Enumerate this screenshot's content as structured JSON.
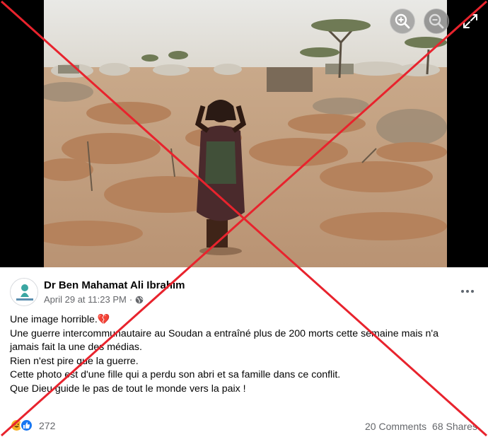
{
  "viewer": {
    "photo_alt": "Girl standing among fresh graves in a dry camp",
    "zoom_in_icon": "zoom-in-icon",
    "zoom_out_icon": "zoom-out-icon",
    "fullscreen_icon": "fullscreen-icon"
  },
  "post": {
    "author": "Dr Ben Mahamat Ali Ibrahim",
    "date": "April 29 at 11:23 PM",
    "separator": "·",
    "audience_icon": "globe-icon",
    "lines": [
      "Une image horrible.",
      "Une guerre intercommunautaire au Soudan a entraîné plus de 200 morts cette semaine mais n'a",
      "jamais fait la une des médias.",
      "Rien n'est pire que la guerre.",
      "Cette photo est d'une fille qui a perdu son abri et sa famille dans ce conflit.",
      "Que Dieu guide le pas de tout le monde vers la paix !"
    ],
    "emoji_after_first_line": "💔"
  },
  "footer": {
    "reaction_count": "272",
    "comments": "20 Comments",
    "shares": "68 Shares"
  },
  "overlay": {
    "cross_color": "#e8232d",
    "meaning": "fact-check-false-cross"
  },
  "colors": {
    "text": "#050505",
    "muted": "#65676b",
    "like_blue": "#1877f2",
    "haha_yellow": "#f7b125"
  }
}
